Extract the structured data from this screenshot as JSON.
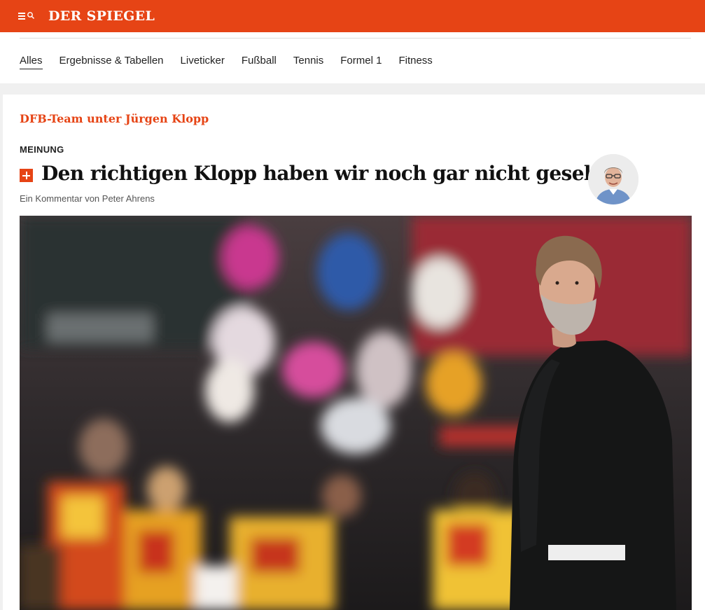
{
  "header": {
    "logo": "DER SPIEGEL",
    "menu_icon": "menu-search-icon",
    "brand_color": "#e64415"
  },
  "nav": {
    "tabs": [
      {
        "label": "Alles",
        "active": true
      },
      {
        "label": "Ergebnisse & Tabellen",
        "active": false
      },
      {
        "label": "Liveticker",
        "active": false
      },
      {
        "label": "Fußball",
        "active": false
      },
      {
        "label": "Tennis",
        "active": false
      },
      {
        "label": "Formel 1",
        "active": false
      },
      {
        "label": "Fitness",
        "active": false
      }
    ]
  },
  "article": {
    "topic": "DFB-Team unter Jürgen Klopp",
    "label": "MEINUNG",
    "plus_icon": "spiegel-plus-icon",
    "headline": "Den richtigen Klopp haben wir noch gar nicht gesehen",
    "byline": "Ein Kommentar von Peter Ahrens",
    "author_avatar": "author-avatar",
    "hero_image": "hero-photo"
  }
}
